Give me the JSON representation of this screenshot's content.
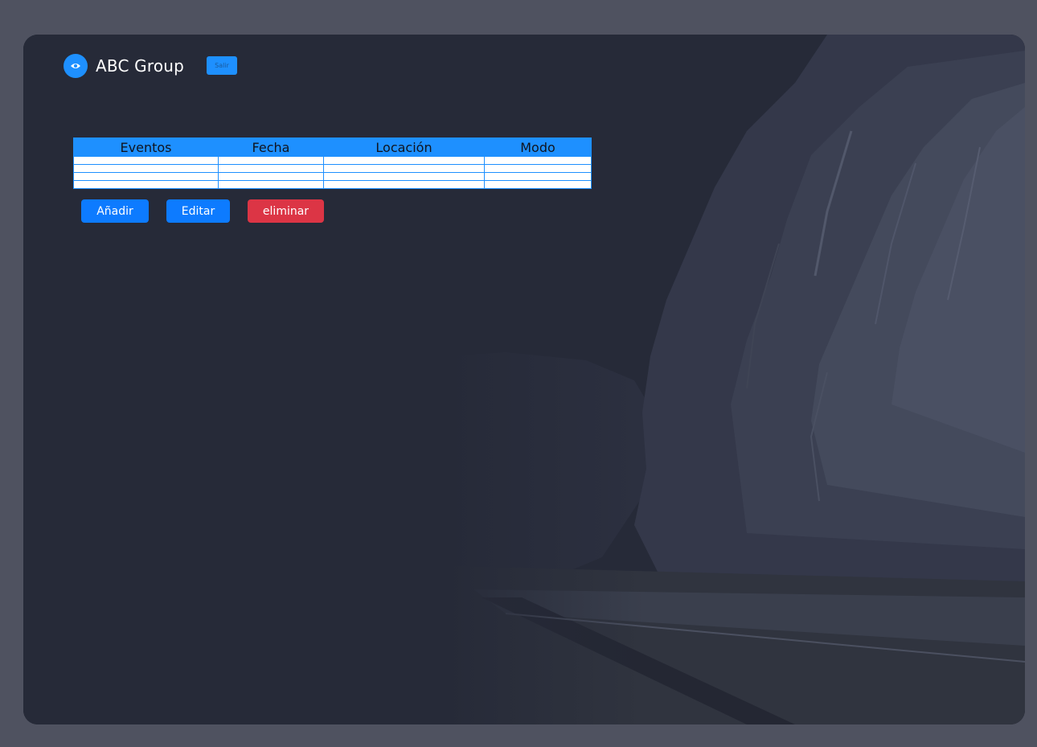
{
  "header": {
    "brand_name": "ABC Group",
    "logo_icon": "eye-icon",
    "logout_label": "Salir"
  },
  "table": {
    "columns": [
      "Eventos",
      "Fecha",
      "Locación",
      "Modo"
    ],
    "rows": [
      [
        "",
        "",
        "",
        ""
      ],
      [
        "",
        "",
        "",
        ""
      ],
      [
        "",
        "",
        "",
        ""
      ],
      [
        "",
        "",
        "",
        ""
      ]
    ]
  },
  "actions": {
    "add_label": "Añadir",
    "edit_label": "Editar",
    "delete_label": "eliminar"
  },
  "colors": {
    "page_bg": "#4f5260",
    "window_bg": "#262a38",
    "accent": "#1e90ff",
    "primary_button": "#0d7bff",
    "danger_button": "#dc3545"
  }
}
